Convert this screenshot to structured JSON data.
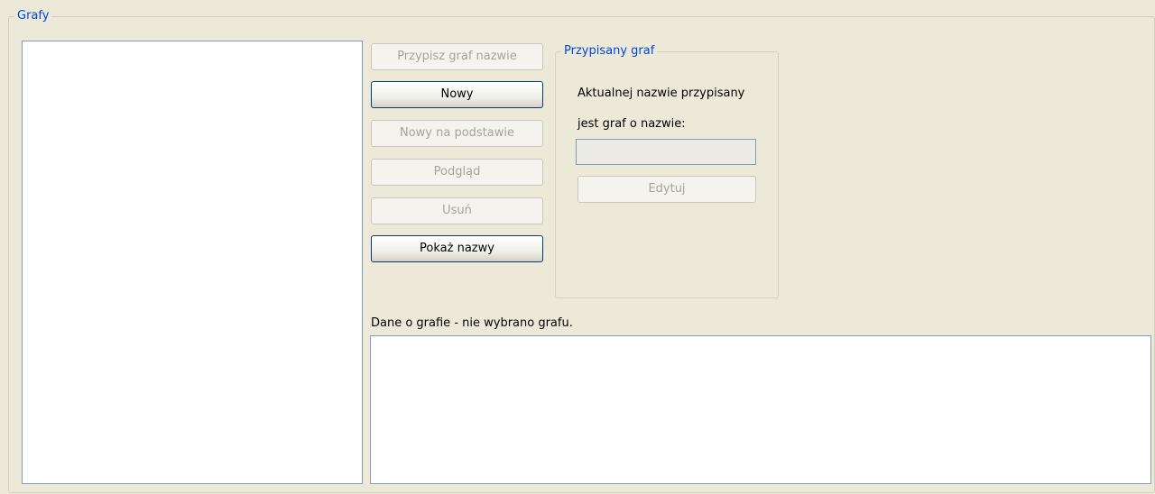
{
  "groups": {
    "graphs_title": "Grafy",
    "assigned_title": "Przypisany graf"
  },
  "buttons": {
    "assign": "Przypisz graf nazwie",
    "new": "Nowy",
    "new_based": "Nowy na podstawie",
    "preview": "Podgląd",
    "delete": "Usuń",
    "show_names": "Pokaż nazwy",
    "edit": "Edytuj"
  },
  "assigned": {
    "line1": "Aktualnej nazwie przypisany",
    "line2": "jest graf o nazwie:",
    "name_value": ""
  },
  "info": {
    "label": "Dane o grafie - nie wybrano grafu.",
    "text": ""
  },
  "colors": {
    "background": "#ece9d8",
    "groupbox_title": "#0046d5",
    "disabled_text": "#a6a497",
    "list_border": "#7f9db9"
  }
}
